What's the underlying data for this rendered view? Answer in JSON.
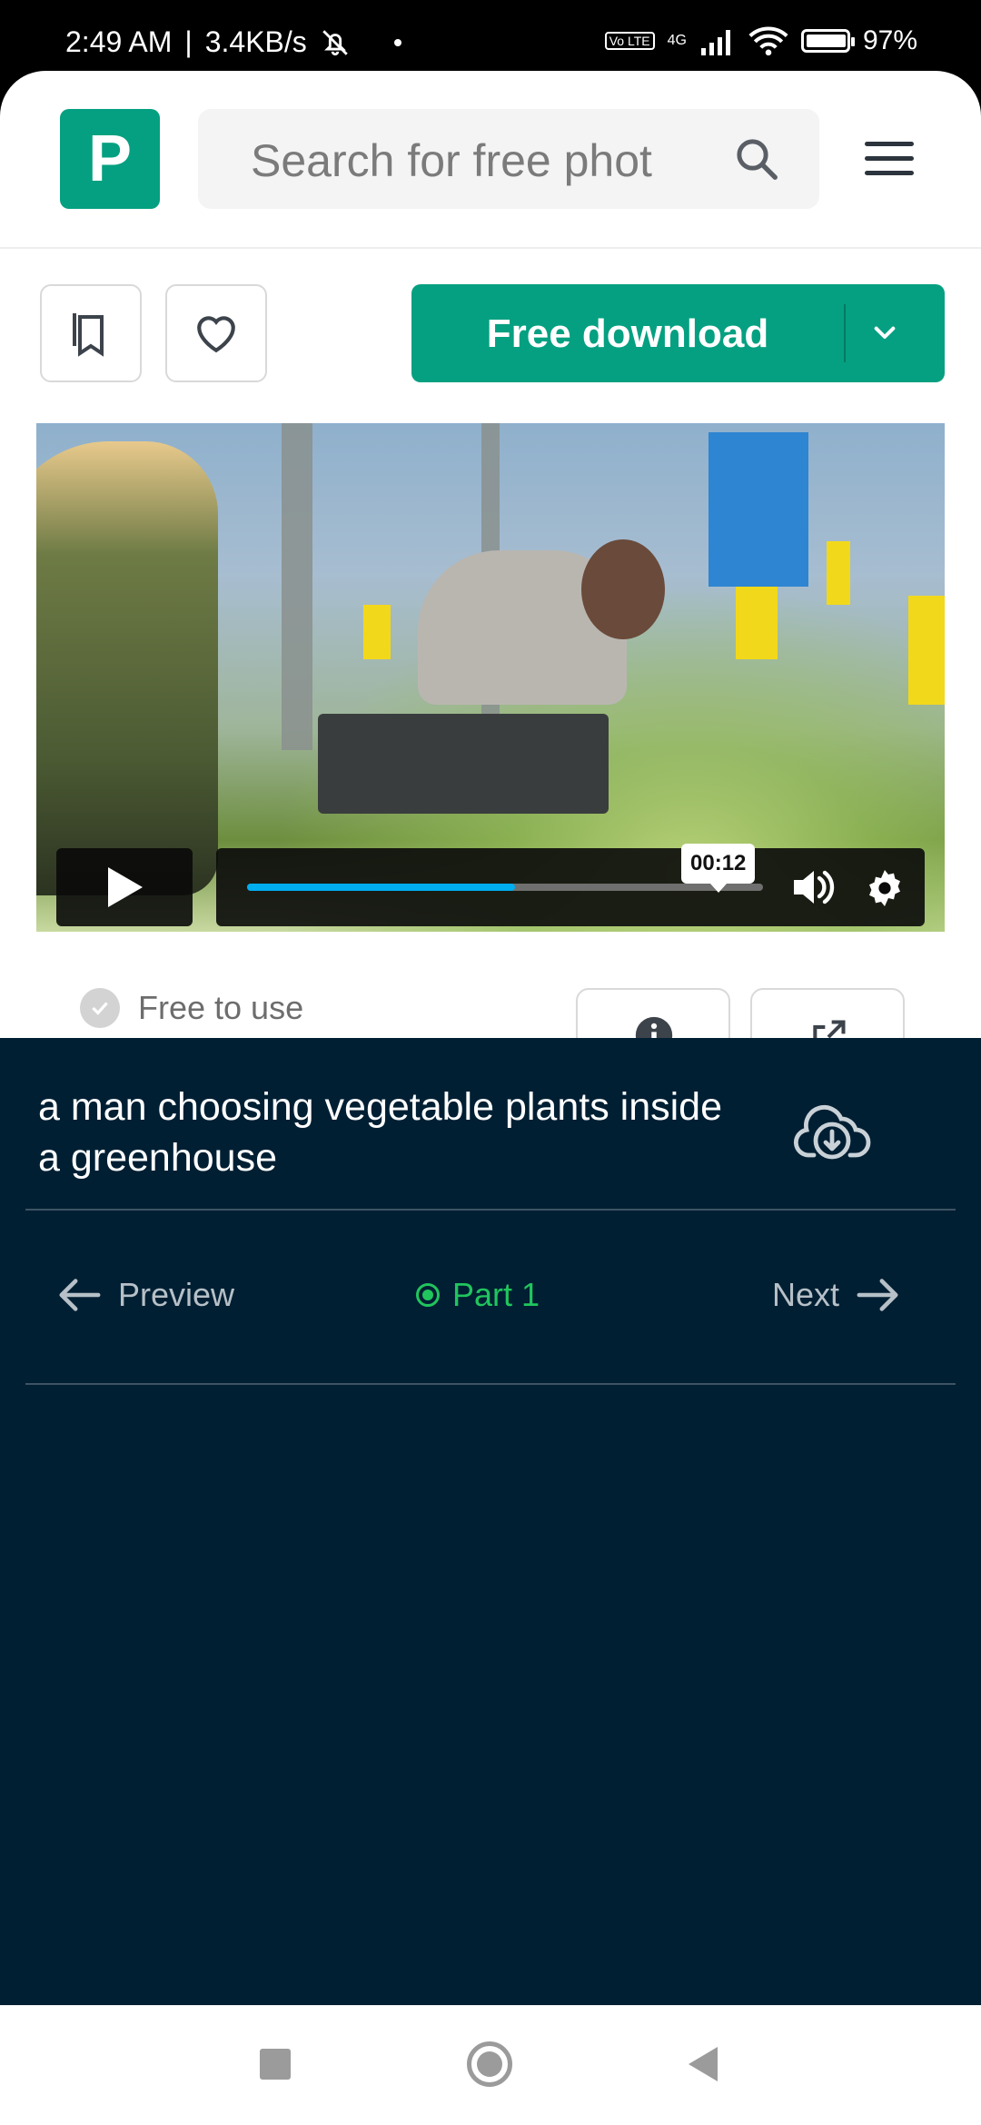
{
  "status_bar": {
    "time": "2:49 AM",
    "net_speed": "3.4KB/s",
    "volte": "Vo LTE",
    "network": "4G",
    "battery": "97%"
  },
  "header": {
    "logo_letter": "P",
    "search_placeholder": "Search for free phot"
  },
  "actions": {
    "download_label": "Free download"
  },
  "video": {
    "current_time": "00:12",
    "progress": 0.52
  },
  "license": {
    "label": "Free to use"
  },
  "panel": {
    "title": "a man choosing vegetable plants inside a greenhouse",
    "nav": {
      "prev_label": "Preview",
      "part_label": "Part 1",
      "next_label": "Next"
    }
  },
  "colors": {
    "brand_green": "#05a081",
    "panel_bg": "#001f33",
    "part_green": "#21c55d",
    "progress_blue": "#00adef"
  }
}
